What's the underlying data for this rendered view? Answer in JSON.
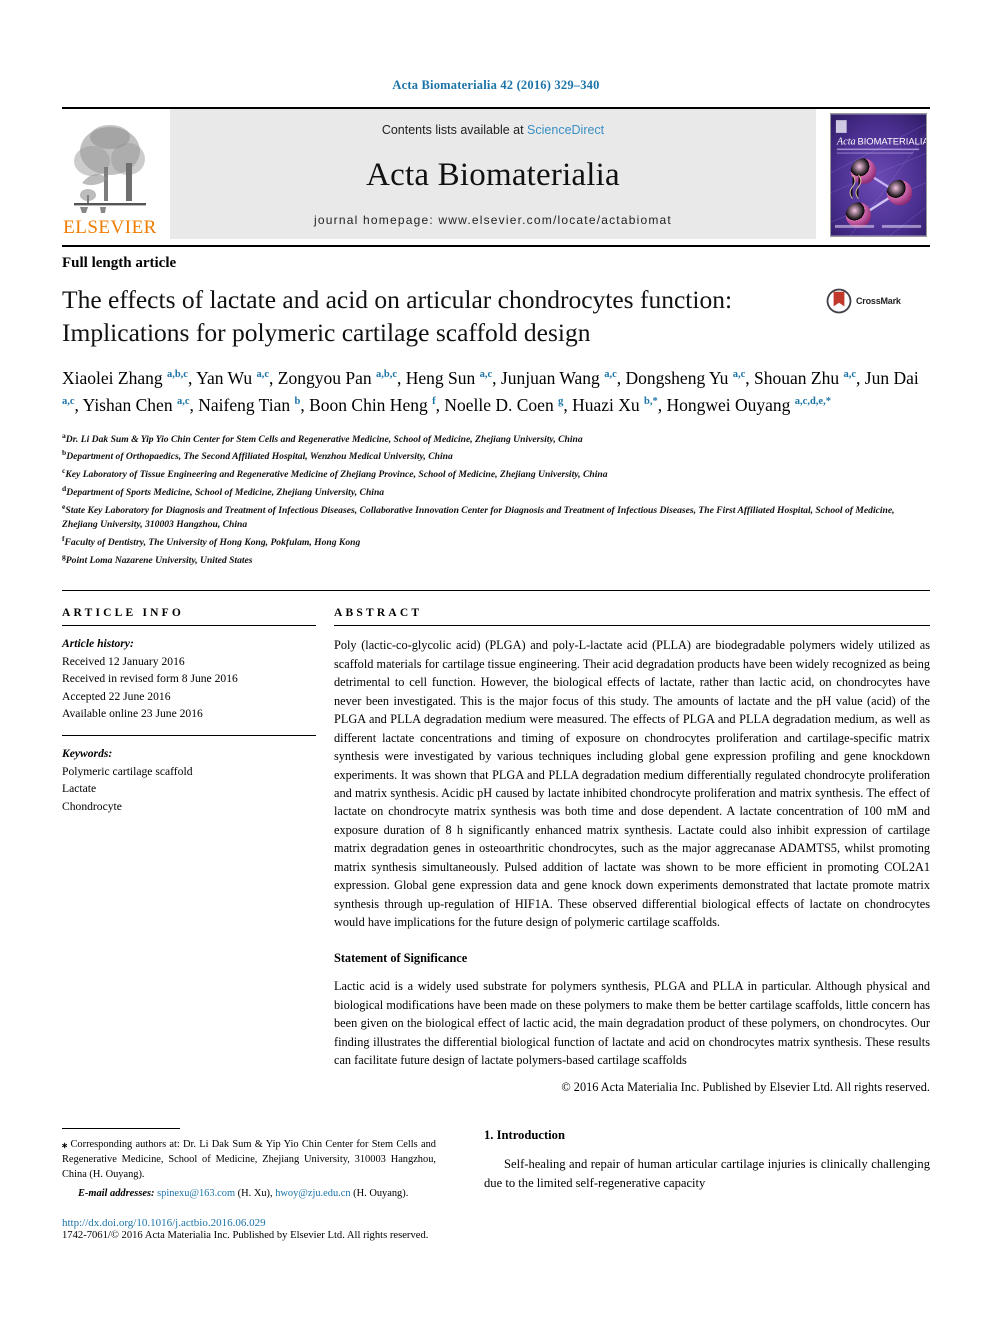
{
  "running_head": "Acta Biomaterialia 42 (2016) 329–340",
  "masthead": {
    "contents_prefix": "Contents lists available at ",
    "sciencedirect": "ScienceDirect",
    "journal_title": "Acta Biomaterialia",
    "homepage": "journal homepage: www.elsevier.com/locate/actabiomat",
    "publisher_wordmark": "ELSEVIER",
    "cover_title": "Acta BIOMATERIALIA",
    "colors": {
      "link_blue": "#3a8fc4",
      "accent_blue": "#1b74a8",
      "elsevier_orange": "#f07c00",
      "masthead_grey": "#e9e9e9",
      "cover_purple": "#4a2f8f"
    }
  },
  "article": {
    "type": "Full length article",
    "title": "The effects of lactate and acid on articular chondrocytes function: Implications for polymeric cartilage scaffold design",
    "crossmark_label": "CrossMark",
    "authors_html": "Xiaolei Zhang <sup>a,b,c</sup>, Yan Wu <sup>a,c</sup>, Zongyou Pan <sup>a,b,c</sup>, Heng Sun <sup>a,c</sup>, Junjuan Wang <sup>a,c</sup>, Dongsheng Yu <sup>a,c</sup>, Shouan Zhu <sup>a,c</sup>, Jun Dai <sup>a,c</sup>, Yishan Chen <sup>a,c</sup>, Naifeng Tian <sup>b</sup>, Boon Chin Heng <sup>f</sup>, Noelle D. Coen <sup>g</sup>, Huazi Xu <sup>b,*</sup>, Hongwei Ouyang <sup>a,c,d,e,*</sup>",
    "affiliations": [
      {
        "marker": "a",
        "text": "Dr. Li Dak Sum & Yip Yio Chin Center for Stem Cells and Regenerative Medicine, School of Medicine, Zhejiang University, China"
      },
      {
        "marker": "b",
        "text": "Department of Orthopaedics, The Second Affiliated Hospital, Wenzhou Medical University, China"
      },
      {
        "marker": "c",
        "text": "Key Laboratory of Tissue Engineering and Regenerative Medicine of Zhejiang Province, School of Medicine, Zhejiang University, China"
      },
      {
        "marker": "d",
        "text": "Department of Sports Medicine, School of Medicine, Zhejiang University, China"
      },
      {
        "marker": "e",
        "text": "State Key Laboratory for Diagnosis and Treatment of Infectious Diseases, Collaborative Innovation Center for Diagnosis and Treatment of Infectious Diseases, The First Affiliated Hospital, School of Medicine, Zhejiang University, 310003 Hangzhou, China"
      },
      {
        "marker": "f",
        "text": "Faculty of Dentistry, The University of Hong Kong, Pokfulam, Hong Kong"
      },
      {
        "marker": "g",
        "text": "Point Loma Nazarene University, United States"
      }
    ]
  },
  "info": {
    "heading": "ARTICLE INFO",
    "history_label": "Article history:",
    "history": [
      "Received 12 January 2016",
      "Received in revised form 8 June 2016",
      "Accepted 22 June 2016",
      "Available online 23 June 2016"
    ],
    "keywords_label": "Keywords:",
    "keywords": [
      "Polymeric cartilage scaffold",
      "Lactate",
      "Chondrocyte"
    ]
  },
  "abstract": {
    "heading": "ABSTRACT",
    "body": "Poly (lactic-co-glycolic acid) (PLGA) and poly-L-lactate acid (PLLA) are biodegradable polymers widely utilized as scaffold materials for cartilage tissue engineering. Their acid degradation products have been widely recognized as being detrimental to cell function. However, the biological effects of lactate, rather than lactic acid, on chondrocytes have never been investigated. This is the major focus of this study. The amounts of lactate and the pH value (acid) of the PLGA and PLLA degradation medium were measured. The effects of PLGA and PLLA degradation medium, as well as different lactate concentrations and timing of exposure on chondrocytes proliferation and cartilage-specific matrix synthesis were investigated by various techniques including global gene expression profiling and gene knockdown experiments. It was shown that PLGA and PLLA degradation medium differentially regulated chondrocyte proliferation and matrix synthesis. Acidic pH caused by lactate inhibited chondrocyte proliferation and matrix synthesis. The effect of lactate on chondrocyte matrix synthesis was both time and dose dependent. A lactate concentration of 100 mM and exposure duration of 8 h significantly enhanced matrix synthesis. Lactate could also inhibit expression of cartilage matrix degradation genes in osteoarthritic chondrocytes, such as the major aggrecanase ADAMTS5, whilst promoting matrix synthesis simultaneously. Pulsed addition of lactate was shown to be more efficient in promoting COL2A1 expression. Global gene expression data and gene knock down experiments demonstrated that lactate promote matrix synthesis through up-regulation of HIF1A. These observed differential biological effects of lactate on chondrocytes would have implications for the future design of polymeric cartilage scaffolds.",
    "significance_heading": "Statement of Significance",
    "significance_body": "Lactic acid is a widely used substrate for polymers synthesis, PLGA and PLLA in particular. Although physical and biological modifications have been made on these polymers to make them be better cartilage scaffolds, little concern has been given on the biological effect of lactic acid, the main degradation product of these polymers, on chondrocytes. Our finding illustrates the differential biological function of lactate and acid on chondrocytes matrix synthesis. These results can facilitate future design of lactate polymers-based cartilage scaffolds",
    "copyright": "© 2016 Acta Materialia Inc. Published by Elsevier Ltd. All rights reserved."
  },
  "footer": {
    "corresponding_star": "⁎",
    "corresponding_text": "Corresponding authors at: Dr. Li Dak Sum & Yip Yio Chin Center for Stem Cells and Regenerative Medicine, School of Medicine, Zhejiang University, 310003 Hangzhou, China (H. Ouyang).",
    "email_label": "E-mail addresses:",
    "email_1": "spinexu@163.com",
    "email_1_owner": "(H. Xu),",
    "email_2": "hwoy@zju.edu.cn",
    "email_2_owner": "(H. Ouyang).",
    "doi": "http://dx.doi.org/10.1016/j.actbio.2016.06.029",
    "issn_line": "1742-7061/© 2016 Acta Materialia Inc. Published by Elsevier Ltd. All rights reserved."
  },
  "introduction": {
    "heading": "1. Introduction",
    "paragraph": "Self-healing and repair of human articular cartilage injuries is clinically challenging due to the limited self-regenerative capacity"
  }
}
